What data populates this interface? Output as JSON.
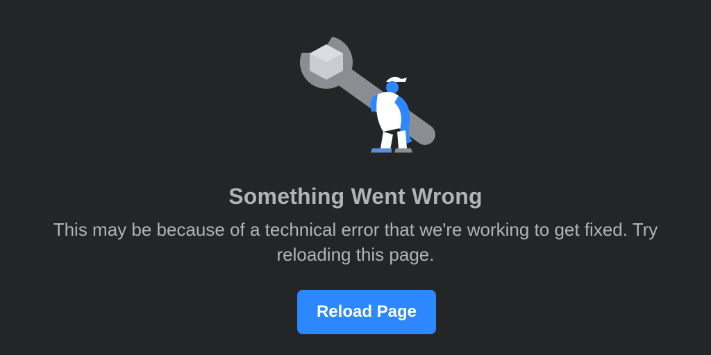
{
  "error": {
    "illustration_icon": "wrench-worker-icon",
    "title": "Something Went Wrong",
    "message": "This may be because of a technical error that we're working to get fixed. Try reloading this page.",
    "reload_label": "Reload Page"
  },
  "colors": {
    "background": "#242526",
    "text": "#b0b3b8",
    "accent": "#2d88ff",
    "button_text": "#ffffff"
  }
}
